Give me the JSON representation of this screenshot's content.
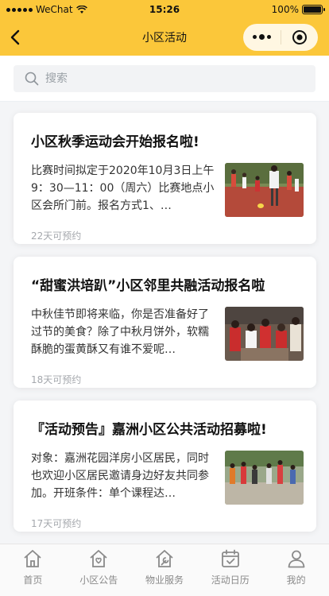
{
  "status_bar": {
    "carrier": "WeChat",
    "time": "15:26",
    "battery": "100%"
  },
  "nav": {
    "title": "小区活动"
  },
  "search": {
    "placeholder": "搜索"
  },
  "cards": [
    {
      "title": "小区秋季运动会开始报名啦!",
      "desc": "比赛时间拟定于2020年10月3日上午9：30—11：00（周六）比赛地点小区会所门前。报名方式1、…",
      "meta": "22天可预约",
      "thumb": "sports-photo"
    },
    {
      "title": "“甜蜜洪培趴”小区邻里共融活动报名啦",
      "desc": "中秋佳节即将来临，你是否准备好了过节的美食？除了中秋月饼外，软糯酥脆的蛋黄酥又有谁不爱呢…",
      "meta": "18天可预约",
      "thumb": "baking-photo"
    },
    {
      "title": "『活动预告』嘉洲小区公共活动招募啦!",
      "desc": "对象：嘉洲花园洋房小区居民，同时也欢迎小区居民邀请身边好友共同参加。开班条件：单个课程达…",
      "meta": "17天可预约",
      "thumb": "outdoor-group-photo"
    }
  ],
  "tabbar": {
    "items": [
      {
        "label": "首页",
        "icon": "home-icon"
      },
      {
        "label": "小区公告",
        "icon": "community-notice-icon"
      },
      {
        "label": "物业服务",
        "icon": "wrench-service-icon"
      },
      {
        "label": "活动日历",
        "icon": "calendar-check-icon"
      },
      {
        "label": "我的",
        "icon": "user-icon"
      }
    ]
  },
  "colors": {
    "header": "#fbc73a",
    "capsule": "#fff7e2",
    "page_bg": "#f4f5f7",
    "meta_text": "#a5a8ad"
  }
}
